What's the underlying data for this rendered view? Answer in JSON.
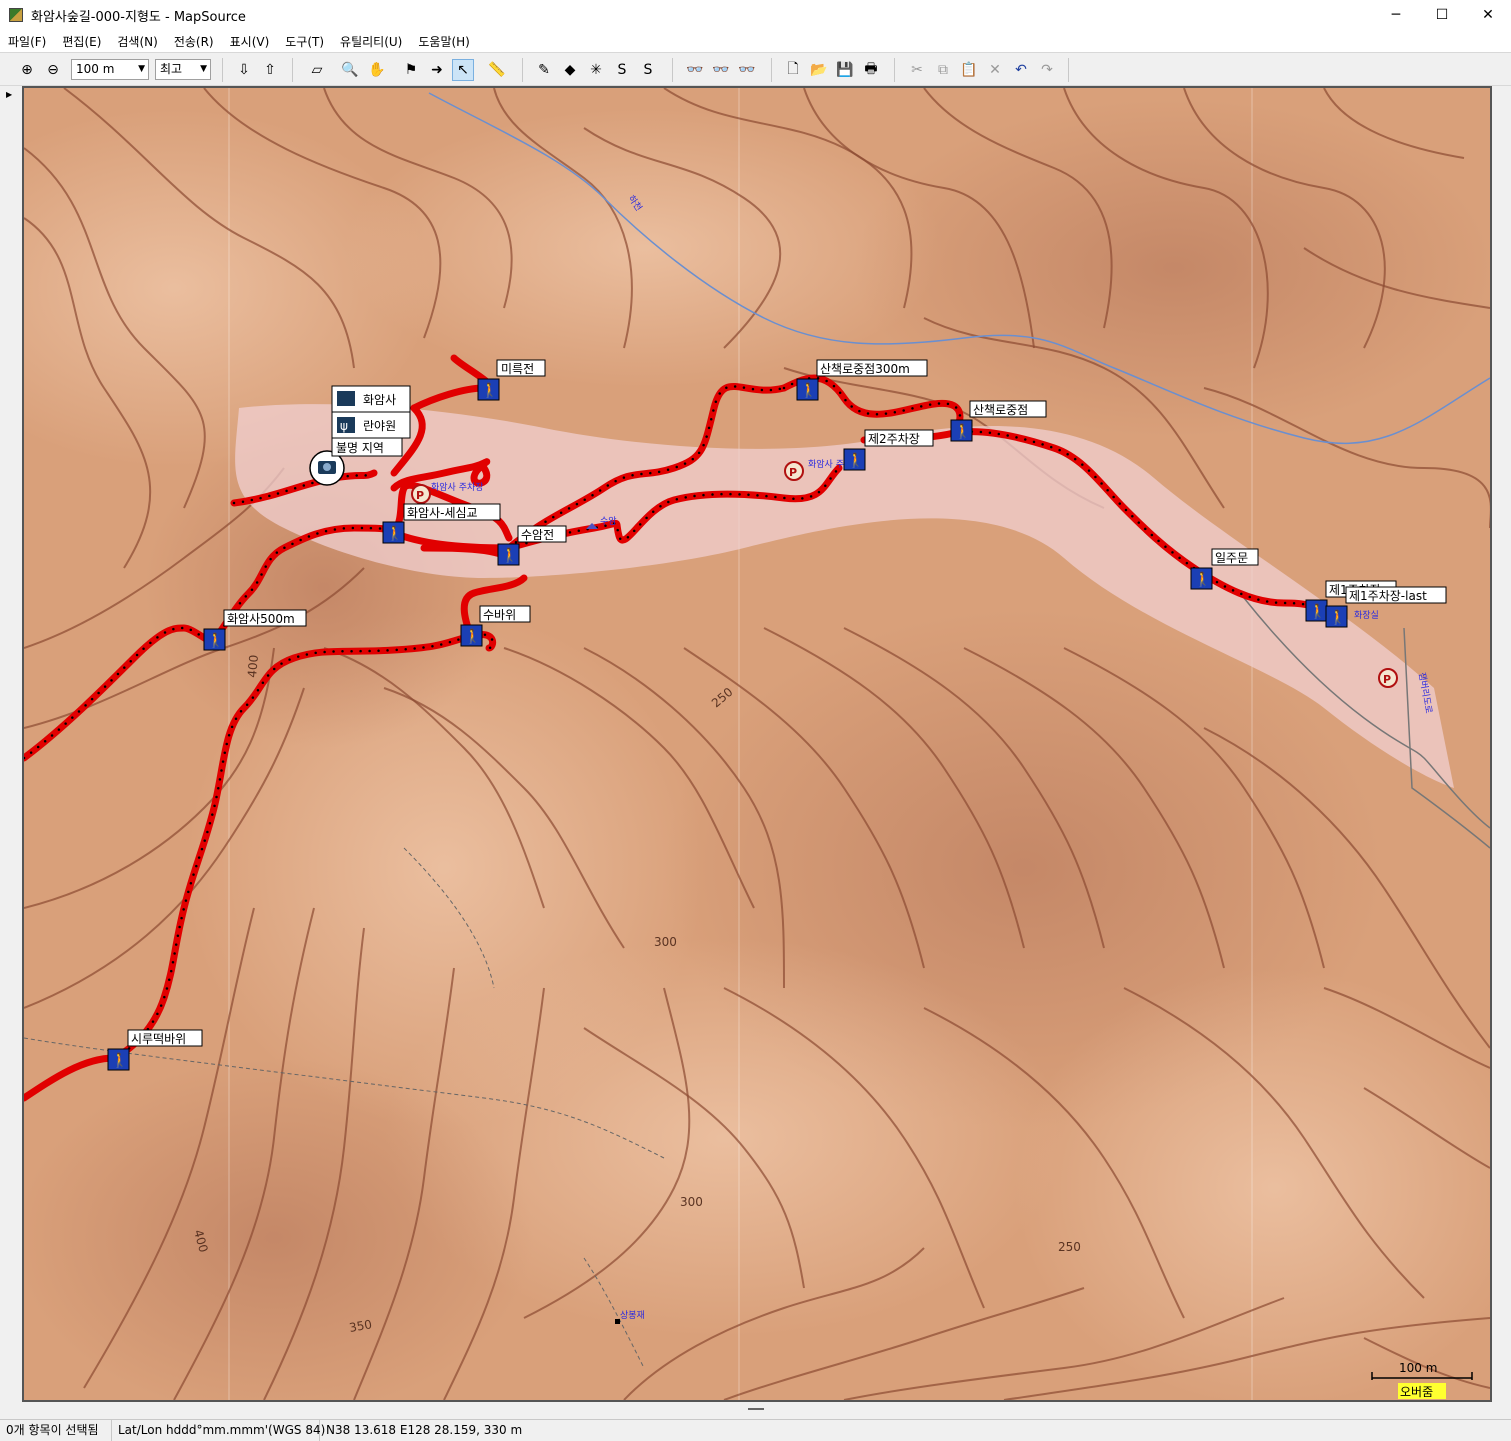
{
  "window": {
    "title": "화암사숲길-000-지형도 - MapSource",
    "min_icon": "─",
    "max_icon": "☐",
    "close_icon": "✕"
  },
  "menu": [
    {
      "label": "파일(F)"
    },
    {
      "label": "편집(E)"
    },
    {
      "label": "검색(N)"
    },
    {
      "label": "전송(R)"
    },
    {
      "label": "표시(V)"
    },
    {
      "label": "도구(T)"
    },
    {
      "label": "유틸리티(U)"
    },
    {
      "label": "도움말(H)"
    }
  ],
  "toolbar": {
    "zoom_scale": "100 m",
    "detail_level": "최고",
    "combo_arrow": "▼",
    "zoom_in_icon": "⊕",
    "zoom_out_icon": "⊖",
    "receive_icon": "⇩",
    "send_icon": "⇧",
    "select_map_icon": "▱",
    "zoom_tool_icon": "🔍",
    "hand_icon": "✋",
    "waypoint_icon": "⚑",
    "route_icon": "➜",
    "select_icon": "↖",
    "measure_icon": "📏",
    "track_icon": "✎",
    "draw_icon": "◆",
    "erase_icon": "✳",
    "trackline_icon": "S",
    "trackbreak_icon": "S",
    "find_icon": "👓",
    "find2_icon": "👓",
    "find3_icon": "👓",
    "new_icon": "🗋",
    "open_icon": "📂",
    "save_icon": "💾",
    "print_icon": "🖶",
    "cut_icon": "✂",
    "copy_icon": "⧉",
    "paste_icon": "📋",
    "delete_icon": "✕",
    "undo_icon": "↶",
    "redo_icon": "↷"
  },
  "map": {
    "colors": {
      "track": "#e10000",
      "terrain": "#d9a07a",
      "contour": "#8c4a32",
      "water": "#6a8fd0",
      "trail_area": "#f0cfd0"
    },
    "waypoints": [
      {
        "label": "미륵전"
      },
      {
        "label": "화암사"
      },
      {
        "label": "란야원"
      },
      {
        "label": "불명 지역"
      },
      {
        "label": "화암사-세심교"
      },
      {
        "label": "수암전"
      },
      {
        "label": "수바위"
      },
      {
        "label": "화암사500m"
      },
      {
        "label": "시루떡바위"
      },
      {
        "label": "산책로중점300m"
      },
      {
        "label": "산책로중점"
      },
      {
        "label": "제2주차장"
      },
      {
        "label": "일주문"
      },
      {
        "label": "제1주차장"
      },
      {
        "label": "제1주차장-last"
      }
    ],
    "place_labels": [
      "화암사 주차장",
      "화암사 주차장",
      "수암",
      "화장실",
      "상봉재",
      "하천",
      "잼버리도로"
    ],
    "contour_labels": [
      "400",
      "250",
      "300",
      "300",
      "250",
      "350",
      "400"
    ],
    "scale_bar": {
      "label": "100 m",
      "overzoom": "오버줌"
    }
  },
  "status": {
    "selection": "0개 항목이 선택됨",
    "coord_format": "Lat/Lon hddd°mm.mmm'(WGS 84)",
    "cursor": "N38 13.618 E128 28.159, 330 m"
  },
  "gutter": {
    "arrow": "▶"
  }
}
